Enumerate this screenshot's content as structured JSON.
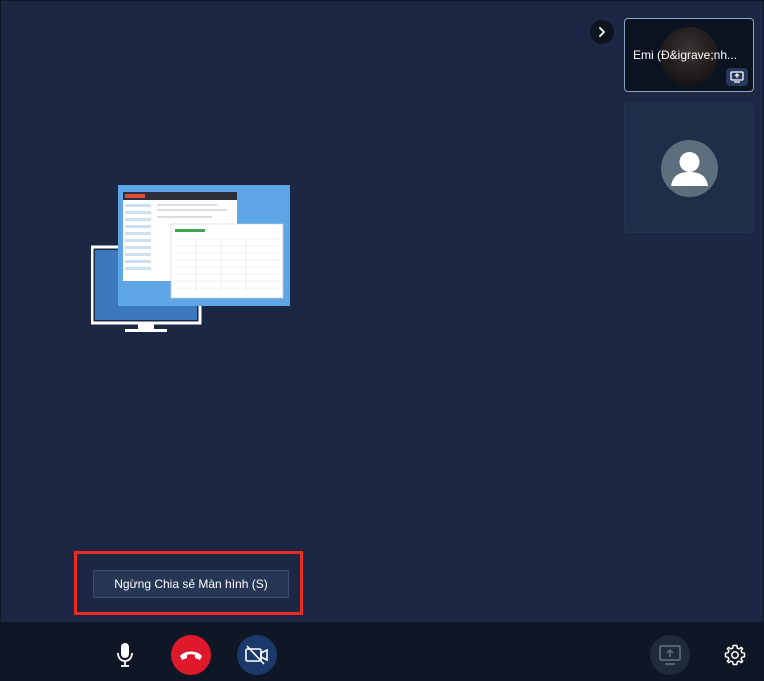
{
  "participants": [
    {
      "name": "Emi (Đ&igrave;nh...",
      "presenting": true,
      "presenting_icon": "screen-share-icon"
    },
    {
      "name": "",
      "avatar_icon": "user-avatar-icon"
    }
  ],
  "collapse_icon": "chevron-right-icon",
  "main": {
    "illustration": "screen-share-illustration",
    "stop_share_label": "Ngừng Chia sẻ Màn hình (S)",
    "highlight_color": "#ec2b22"
  },
  "toolbar": {
    "mic_icon": "microphone-icon",
    "hangup_icon": "phone-hangup-icon",
    "camera_icon": "camera-off-icon",
    "share_icon": "screen-share-icon",
    "settings_icon": "gear-icon",
    "hangup_color": "#e0182c",
    "camera_color": "#1b3a6b"
  }
}
